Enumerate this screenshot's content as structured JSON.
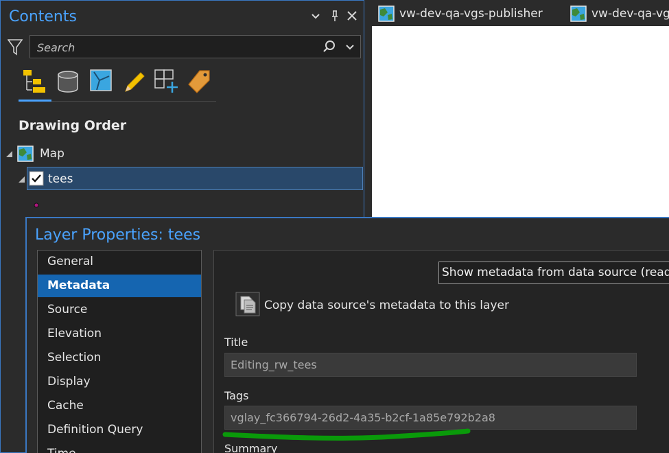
{
  "contents_pane": {
    "title": "Contents",
    "search": {
      "placeholder": "Search",
      "value": ""
    },
    "section_title": "Drawing Order",
    "tree": {
      "map_label": "Map",
      "layer_label": "tees"
    },
    "toolbar_icons": [
      "list-by-drawing-order-icon",
      "list-by-data-source-icon",
      "list-by-selection-icon",
      "list-by-editing-icon",
      "list-by-snapping-icon",
      "list-by-labeling-icon"
    ]
  },
  "map_tabs": [
    {
      "label": "vw-dev-qa-vgs-publisher"
    },
    {
      "label": "vw-dev-qa-vg"
    }
  ],
  "dialog": {
    "title": "Layer Properties: tees",
    "nav_items": [
      {
        "label": "General",
        "selected": false
      },
      {
        "label": "Metadata",
        "selected": true
      },
      {
        "label": "Source",
        "selected": false
      },
      {
        "label": "Elevation",
        "selected": false
      },
      {
        "label": "Selection",
        "selected": false
      },
      {
        "label": "Display",
        "selected": false
      },
      {
        "label": "Cache",
        "selected": false
      },
      {
        "label": "Definition Query",
        "selected": false
      },
      {
        "label": "Time",
        "selected": false
      }
    ],
    "metadata_option": "Show metadata from data source (read-only)",
    "copy_label": "Copy data source's metadata to this layer",
    "fields": {
      "title_label": "Title",
      "title_value": "Editing_rw_tees",
      "tags_label": "Tags",
      "tags_value": "vglay_fc366794-26d2-4a35-b2cf-1a85e792b2a8",
      "summary_label": "Summary"
    }
  },
  "colors": {
    "accent": "#4aa3ff",
    "selection": "#1565b0",
    "annotation": "#0a9a0a"
  }
}
